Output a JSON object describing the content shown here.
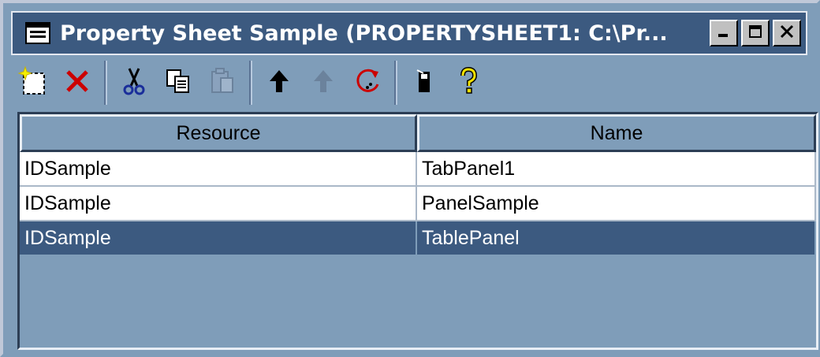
{
  "window": {
    "title": "Property Sheet Sample (PROPERTYSHEET1: C:\\Pr...",
    "title_icon": "window-app-icon",
    "controls": [
      "minimize-icon",
      "maximize-icon",
      "close-icon"
    ]
  },
  "toolbar": {
    "tools": [
      {
        "name": "new-button",
        "icon": "new-item-icon",
        "enabled": true
      },
      {
        "name": "delete-button",
        "icon": "delete-x-icon",
        "enabled": true
      },
      {
        "name": "cut-button",
        "icon": "scissors-icon",
        "enabled": true
      },
      {
        "name": "copy-button",
        "icon": "copy-icon",
        "enabled": true
      },
      {
        "name": "paste-button",
        "icon": "paste-icon",
        "enabled": false
      },
      {
        "name": "move-up-button",
        "icon": "arrow-up-icon",
        "enabled": true
      },
      {
        "name": "move-down-button",
        "icon": "arrow-down-icon",
        "enabled": false
      },
      {
        "name": "refresh-button",
        "icon": "refresh-icon",
        "enabled": true
      },
      {
        "name": "properties-button",
        "icon": "properties-icon",
        "enabled": true
      },
      {
        "name": "help-button",
        "icon": "help-question-icon",
        "enabled": true
      }
    ]
  },
  "table": {
    "columns": [
      "Resource",
      "Name"
    ],
    "rows": [
      {
        "resource": "IDSample",
        "name": "TabPanel1",
        "selected": false
      },
      {
        "resource": "IDSample",
        "name": "PanelSample",
        "selected": false
      },
      {
        "resource": "IDSample",
        "name": "TablePanel",
        "selected": true
      }
    ]
  },
  "colors": {
    "title_bar": "#3c5a80",
    "background": "#7f9db9",
    "selection": "#3c5a80",
    "delete_red": "#cc0000",
    "help_yellow": "#f0e000"
  }
}
